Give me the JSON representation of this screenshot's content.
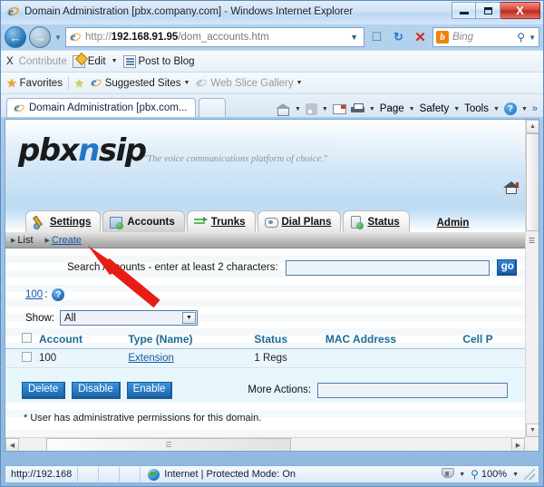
{
  "window": {
    "title": "Domain Administration [pbx.company.com] - Windows Internet Explorer",
    "minimize_label": "Minimize",
    "maximize_label": "Maximize",
    "close_label": "X"
  },
  "address_bar": {
    "url_protocol": "http://",
    "url_host": "192.168.91.95",
    "url_path": "/dom_accounts.htm",
    "dropdown_caret": "▼",
    "compatibility_label": "Compatibility View",
    "refresh_label": "↻",
    "stop_label": "✕",
    "search_placeholder": "Bing",
    "search_brand": "b",
    "search_caret": "▼"
  },
  "contribute_bar": {
    "close_label": "X",
    "contribute_label": "Contribute",
    "edit_label": "Edit",
    "edit_caret": "▼",
    "post_to_blog_label": "Post to Blog"
  },
  "favorites_bar": {
    "favorites_label": "Favorites",
    "suggested_sites_label": "Suggested Sites",
    "suggested_caret": "▼",
    "web_slice_label": "Web Slice Gallery",
    "web_slice_caret": "▼"
  },
  "tab_strip": {
    "tabs": [
      {
        "label": "Domain Administration [pbx.com..."
      }
    ],
    "tools": {
      "home_caret": "▼",
      "feeds_caret": "▼",
      "print_caret": "▼",
      "page_label": "Page",
      "page_caret": "▼",
      "safety_label": "Safety",
      "safety_caret": "▼",
      "tools_label": "Tools",
      "tools_caret": "▼",
      "help_label": "?",
      "help_caret": "▼",
      "overflow_label": "»"
    }
  },
  "page": {
    "banner": {
      "logo_part1": "pbx",
      "logo_part2": "n",
      "logo_part3": "sip",
      "tagline": "\"The voice communications platform of choice.\""
    },
    "nav_tabs": [
      {
        "label": "Settings",
        "icon": "wrench-icon",
        "active": false
      },
      {
        "label": "Accounts",
        "icon": "accounts-icon",
        "active": true
      },
      {
        "label": "Trunks",
        "icon": "trunks-icon",
        "active": false
      },
      {
        "label": "Dial Plans",
        "icon": "dialplan-icon",
        "active": false
      },
      {
        "label": "Status",
        "icon": "status-icon",
        "active": false
      }
    ],
    "admin_link": "Admin",
    "breadcrumbs": [
      {
        "label": "List",
        "is_link": false
      },
      {
        "label": "Create",
        "is_link": true
      }
    ],
    "search": {
      "label": "Search Accounts - enter at least 2 characters:",
      "value": "",
      "go_button": "go"
    },
    "count_link": "100",
    "count_suffix": ":",
    "help_badge": "?",
    "show": {
      "label": "Show:",
      "selected": "All",
      "caret": "▼",
      "options": [
        "All"
      ]
    },
    "table": {
      "columns": [
        "",
        "Account",
        "Type (Name)",
        "Status",
        "MAC Address",
        "Cell P"
      ],
      "rows": [
        {
          "checked": false,
          "account": "100",
          "type_name": "Extension",
          "status": "1 Regs",
          "mac_address": "",
          "cell_phone": ""
        }
      ]
    },
    "actions": {
      "delete_label": "Delete",
      "disable_label": "Disable",
      "enable_label": "Enable",
      "more_actions_label": "More Actions:",
      "more_actions_value": ""
    },
    "footnote": "* User has administrative permissions for this domain."
  },
  "status_bar": {
    "url": "http://192.168",
    "zone": "Internet | Protected Mode: On",
    "zone_icon": "globe-icon",
    "privacy_caret": "▼",
    "zoom_level": "100%",
    "zoom_caret": "▼"
  },
  "annotation": {
    "arrow_color": "#e81c15",
    "points_to": "Create"
  },
  "colors": {
    "accent_blue": "#1559a8",
    "header_teal": "#1b6b96",
    "button_blue": "#1d68ae",
    "logo_blue": "#2676c4",
    "row_bg": "#eaf6fb",
    "annotation_red": "#e81c15"
  }
}
